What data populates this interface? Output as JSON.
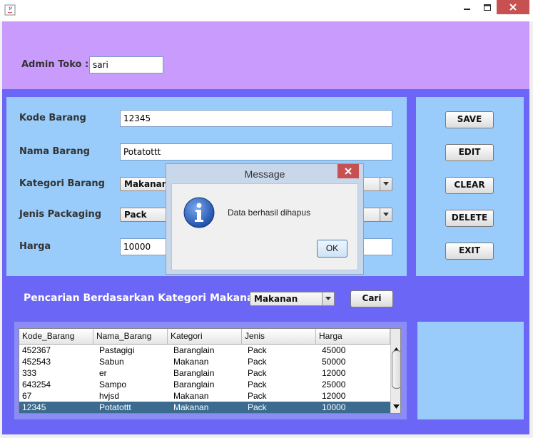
{
  "window": {
    "minimize_icon": "minimize-icon",
    "maximize_icon": "maximize-icon",
    "close_icon": "close-icon"
  },
  "admin": {
    "label": "Admin Toko :",
    "value": "sari"
  },
  "form": {
    "kode_label": "Kode Barang",
    "kode_value": "12345",
    "nama_label": "Nama Barang",
    "nama_value": "Potatottt",
    "kategori_label": "Kategori Barang",
    "kategori_value": "Makanan",
    "jenis_label": "Jenis Packaging",
    "jenis_value": "Pack",
    "harga_label": "Harga",
    "harga_value": "10000"
  },
  "buttons": {
    "save": "SAVE",
    "edit": "EDIT",
    "clear": "CLEAR",
    "delete": "DELETE",
    "exit": "EXIT"
  },
  "search": {
    "label": "Pencarian Berdasarkan Kategori Makanan",
    "category": "Makanan",
    "button": "Cari"
  },
  "table": {
    "columns": [
      "Kode_Barang",
      "Nama_Barang",
      "Kategori",
      "Jenis",
      "Harga"
    ],
    "rows": [
      [
        "452367",
        "Pastagigi",
        "Baranglain",
        "Pack",
        "45000"
      ],
      [
        "452543",
        "Sabun",
        "Makanan",
        "Pack",
        "50000"
      ],
      [
        "333",
        "er",
        "Baranglain",
        "Pack",
        "12000"
      ],
      [
        "643254",
        "Sampo",
        "Baranglain",
        "Pack",
        "25000"
      ],
      [
        "67",
        "hvjsd",
        "Makanan",
        "Pack",
        "12000"
      ],
      [
        "12345",
        "Potatottt",
        "Makanan",
        "Pack",
        "10000"
      ]
    ],
    "selected_row": 5
  },
  "dialog": {
    "title": "Message",
    "message": "Data berhasil dihapus",
    "ok": "OK",
    "icon": "info-icon"
  },
  "colors": {
    "admin_bg": "#c99bfd",
    "frame_bg": "#6b66f5",
    "panel_bg": "#99ccfa",
    "selection": "#3b6b8e"
  }
}
